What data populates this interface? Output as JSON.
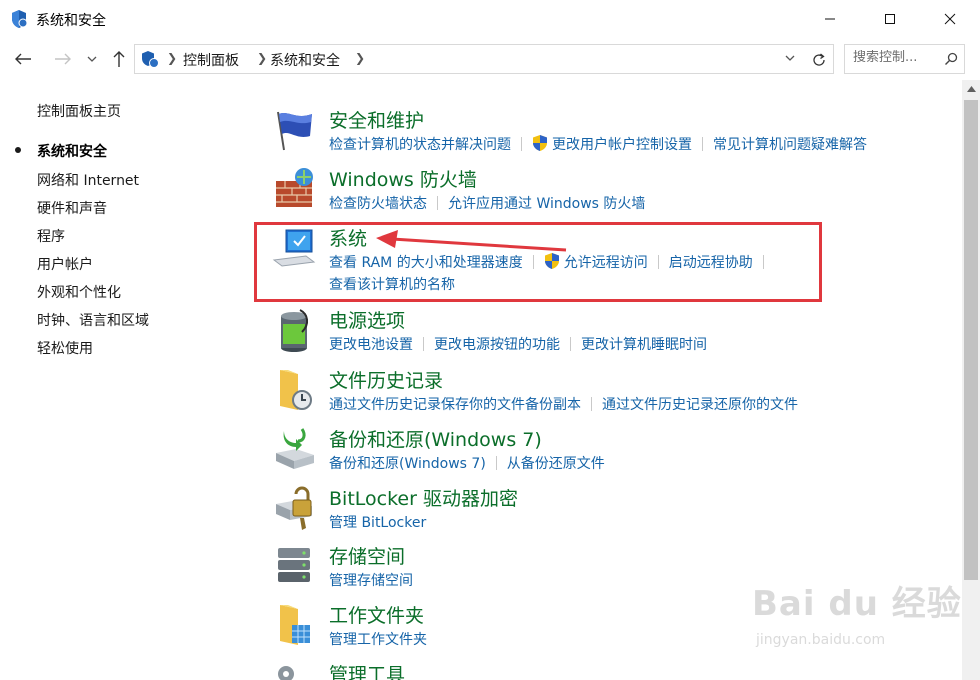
{
  "window": {
    "title": "系统和安全",
    "icon": "shield-icon"
  },
  "address": {
    "crumbs": [
      "控制面板",
      "系统和安全"
    ],
    "search_placeholder": "搜索控制..."
  },
  "leftnav": {
    "items": [
      {
        "label": "控制面板主页",
        "active": false
      },
      {
        "label": "系统和安全",
        "active": true
      },
      {
        "label": "网络和 Internet",
        "active": false
      },
      {
        "label": "硬件和声音",
        "active": false
      },
      {
        "label": "程序",
        "active": false
      },
      {
        "label": "用户帐户",
        "active": false
      },
      {
        "label": "外观和个性化",
        "active": false
      },
      {
        "label": "时钟、语言和区域",
        "active": false
      },
      {
        "label": "轻松使用",
        "active": false
      }
    ]
  },
  "categories": [
    {
      "title": "安全和维护",
      "icon": "flag-icon",
      "links": [
        "检查计算机的状态并解决问题",
        "更改用户帐户控制设置",
        "常见计算机问题疑难解答"
      ]
    },
    {
      "title": "Windows 防火墙",
      "icon": "firewall-icon",
      "links": [
        "检查防火墙状态",
        "允许应用通过 Windows 防火墙"
      ]
    },
    {
      "title": "系统",
      "icon": "computer-icon",
      "links": [
        "查看 RAM 的大小和处理器速度",
        "允许远程访问",
        "启动远程协助"
      ],
      "line2": "查看该计算机的名称"
    },
    {
      "title": "电源选项",
      "icon": "battery-icon",
      "links": [
        "更改电池设置",
        "更改电源按钮的功能",
        "更改计算机睡眠时间"
      ]
    },
    {
      "title": "文件历史记录",
      "icon": "file-history-icon",
      "links": [
        "通过文件历史记录保存你的文件备份副本",
        "通过文件历史记录还原你的文件"
      ]
    },
    {
      "title": "备份和还原(Windows 7)",
      "icon": "backup-icon",
      "links": [
        "备份和还原(Windows 7)",
        "从备份还原文件"
      ]
    },
    {
      "title": "BitLocker 驱动器加密",
      "icon": "bitlocker-icon",
      "links": [
        "管理 BitLocker"
      ]
    },
    {
      "title": "存储空间",
      "icon": "storage-icon",
      "links": [
        "管理存储空间"
      ]
    },
    {
      "title": "工作文件夹",
      "icon": "work-folders-icon",
      "links": [
        "管理工作文件夹"
      ]
    },
    {
      "title": "管理工具",
      "icon": "admin-tools-icon",
      "links": []
    }
  ],
  "watermark": {
    "text": "Bai du 经验",
    "sub": "jingyan.baidu.com"
  },
  "colors": {
    "title_green": "#0b6e2a",
    "link_blue": "#1664a8",
    "highlight_red": "#e0383e"
  }
}
